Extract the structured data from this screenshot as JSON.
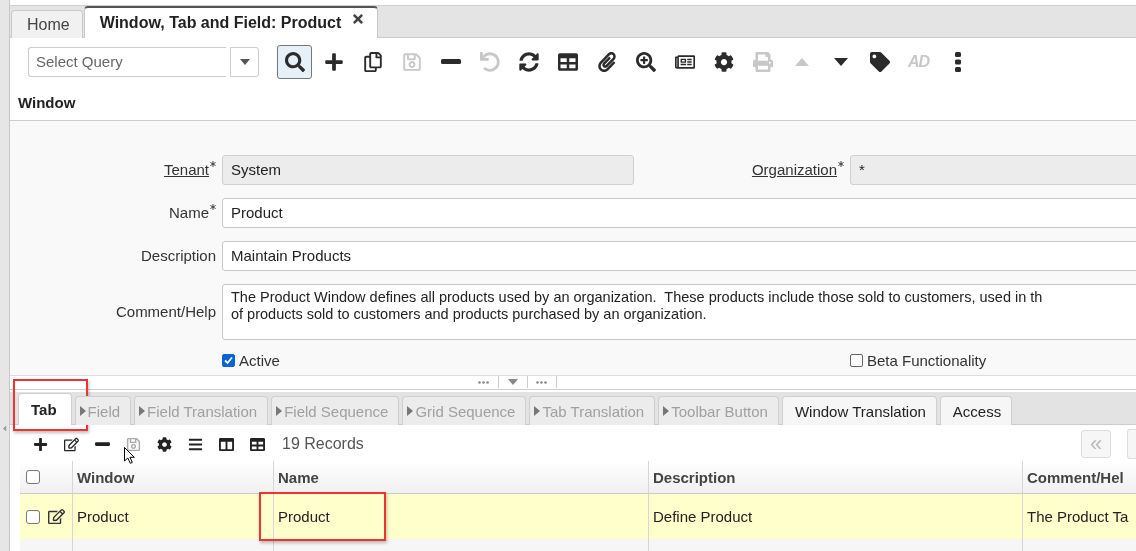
{
  "tabs": [
    {
      "label": "Home",
      "selected": false,
      "closable": false
    },
    {
      "label": "Window, Tab and Field: Product",
      "selected": true,
      "closable": true
    }
  ],
  "query": {
    "placeholder": "Select Query"
  },
  "toolbar": [
    {
      "kind": "search",
      "disabled": false,
      "selected": true
    },
    {
      "kind": "new",
      "disabled": false,
      "selected": false
    },
    {
      "kind": "copy",
      "disabled": false,
      "selected": false
    },
    {
      "kind": "save",
      "disabled": true,
      "selected": false
    },
    {
      "kind": "delete",
      "disabled": false,
      "selected": false
    },
    {
      "kind": "undo",
      "disabled": true,
      "selected": false
    },
    {
      "kind": "refresh",
      "disabled": false,
      "selected": false
    },
    {
      "kind": "grid",
      "disabled": false,
      "selected": false
    },
    {
      "kind": "attach",
      "disabled": false,
      "selected": false
    },
    {
      "kind": "zoom",
      "disabled": false,
      "selected": false
    },
    {
      "kind": "report",
      "disabled": false,
      "selected": false
    },
    {
      "kind": "settings",
      "disabled": false,
      "selected": false
    },
    {
      "kind": "print",
      "disabled": true,
      "selected": false
    },
    {
      "kind": "up",
      "disabled": true,
      "selected": false
    },
    {
      "kind": "down",
      "disabled": false,
      "selected": false
    },
    {
      "kind": "tag",
      "disabled": false,
      "selected": false
    },
    {
      "kind": "logo",
      "label": "AD",
      "disabled": true,
      "selected": false
    },
    {
      "kind": "more",
      "disabled": false,
      "selected": false
    }
  ],
  "section": {
    "title": "Window"
  },
  "form": {
    "top_row": [
      {
        "kind": "text",
        "label": "Tenant",
        "required": true,
        "link": true,
        "value": "System",
        "readonly": true
      },
      {
        "kind": "text",
        "label": "Organization",
        "required": true,
        "link": true,
        "value": "*",
        "readonly": true
      }
    ],
    "fields": [
      {
        "kind": "text",
        "label": "Name",
        "required": true,
        "link": false,
        "value": "Product",
        "readonly": false
      },
      {
        "kind": "text",
        "label": "Description",
        "link": false,
        "value": "Maintain Products",
        "readonly": false
      },
      {
        "kind": "textarea",
        "label": "Comment/Help",
        "link": false,
        "lines": [
          "The Product Window defines all products used by an organization.  These products include those sold to customers, used in th",
          "of products sold to customers and products purchased by an organization."
        ],
        "readonly": false
      }
    ],
    "checkboxes": [
      {
        "label": "Active",
        "checked": true
      },
      {
        "label": "Beta Functionality",
        "checked": false
      }
    ]
  },
  "detail_tabs": [
    {
      "label": "Tab",
      "selected": true,
      "disabled": false,
      "child": false,
      "highlighted": true
    },
    {
      "label": "Field",
      "selected": false,
      "disabled": true,
      "child": true,
      "highlighted": false
    },
    {
      "label": "Field Translation",
      "selected": false,
      "disabled": true,
      "child": true,
      "highlighted": false
    },
    {
      "label": "Field Sequence",
      "selected": false,
      "disabled": true,
      "child": true,
      "highlighted": false
    },
    {
      "label": "Grid Sequence",
      "selected": false,
      "disabled": true,
      "child": true,
      "highlighted": false
    },
    {
      "label": "Tab Translation",
      "selected": false,
      "disabled": true,
      "child": true,
      "highlighted": false
    },
    {
      "label": "Toolbar Button",
      "selected": false,
      "disabled": true,
      "child": true,
      "highlighted": false
    },
    {
      "label": "Window Translation",
      "selected": false,
      "disabled": false,
      "child": false,
      "highlighted": false
    },
    {
      "label": "Access",
      "selected": false,
      "disabled": false,
      "child": false,
      "highlighted": false
    }
  ],
  "detail_toolbar": [
    {
      "kind": "new",
      "disabled": false
    },
    {
      "kind": "edit",
      "disabled": false
    },
    {
      "kind": "delete",
      "disabled": false
    },
    {
      "kind": "save",
      "disabled": true
    },
    {
      "kind": "settings",
      "disabled": false
    },
    {
      "kind": "list",
      "disabled": false
    },
    {
      "kind": "columns",
      "disabled": false
    },
    {
      "kind": "grid",
      "disabled": false
    }
  ],
  "record_count": "19 Records",
  "paging": [
    {
      "label": "«",
      "disabled": true
    }
  ],
  "grid": {
    "columns": [
      "Window",
      "Name",
      "Description",
      "Comment/Hel"
    ],
    "all_checked": false,
    "rows": [
      {
        "selected": true,
        "checked": false,
        "cells": [
          {
            "text": "Product",
            "highlighted": false
          },
          {
            "text": "Product",
            "highlighted": true
          },
          {
            "text": "Define Product",
            "highlighted": false
          },
          {
            "text": "The Product Ta",
            "highlighted": false
          }
        ]
      }
    ]
  }
}
